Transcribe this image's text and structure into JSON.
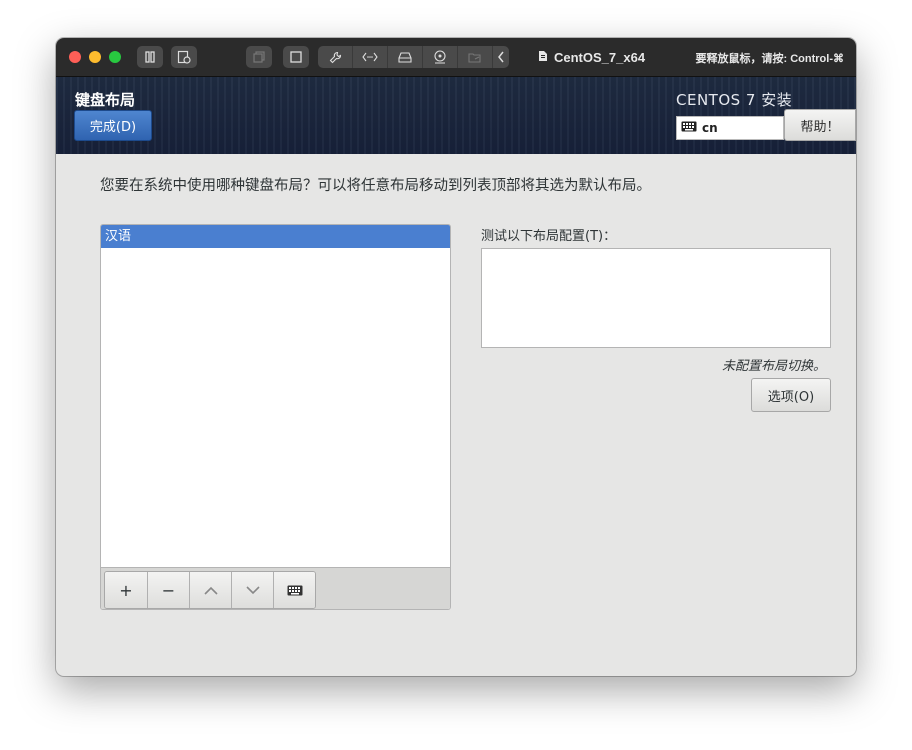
{
  "vm_toolbar": {
    "vm_name": "CentOS_7_x64",
    "release_hint": "要释放鼠标，请按: Control-⌘",
    "icons": [
      "pause-icon",
      "snapshot-icon",
      "copy-icon",
      "fullscreen-icon",
      "wrench-icon",
      "network-icon",
      "disk-icon",
      "camera-icon",
      "shared-folder-icon",
      "chevron-left-icon",
      "document-icon"
    ]
  },
  "header": {
    "spoke_title": "键盘布局",
    "done_label": "完成(D)",
    "product_title": "CENTOS 7 安装",
    "keyboard_indicator": "cn",
    "help_label": "帮助！"
  },
  "main": {
    "question": "您要在系统中使用哪种键盘布局？可以将任意布局移动到列表顶部将其选为默认布局。",
    "layouts": [
      {
        "label": "汉语",
        "selected": true
      }
    ],
    "toolbar": {
      "add": "+",
      "remove": "−",
      "up": "∧",
      "down": "∨"
    },
    "test_label": "测试以下布局配置(T)：",
    "test_value": "",
    "switch_note": "未配置布局切换。",
    "options_label": "选项(O)"
  },
  "colors": {
    "accent": "#4a7fd0",
    "header_bg": "#1c2840",
    "body_bg": "#e6e6e5"
  }
}
